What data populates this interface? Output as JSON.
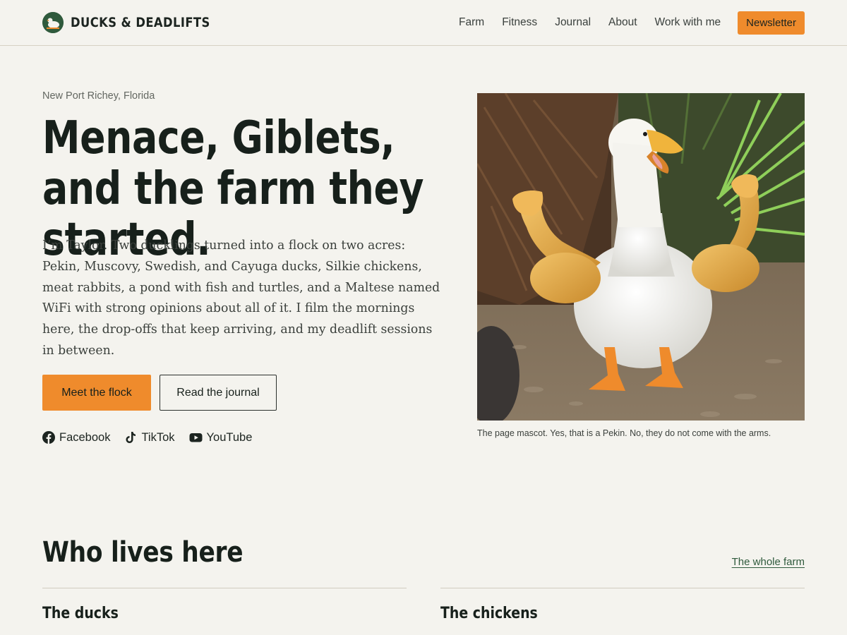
{
  "header": {
    "brand": "DUCKS & DEADLIFTS",
    "nav": [
      "Farm",
      "Fitness",
      "Journal",
      "About",
      "Work with me"
    ],
    "newsletter_label": "Newsletter"
  },
  "hero": {
    "location": "New Port Richey, Florida",
    "title": "Menace, Giblets, and the farm they started.",
    "intro": "I’m Taylor. Two ducklings turned into a flock on two acres: Pekin, Muscovy, Swedish, and Cayuga ducks, Silkie chickens, meat rabbits, a pond with fish and turtles, and a Maltese named WiFi with strong opinions about all of it. I film the mornings here, the drop-offs that keep arriving, and my deadlift sessions in between.",
    "primary_cta": "Meet the flock",
    "secondary_cta": "Read the journal",
    "socials": [
      {
        "label": "Facebook",
        "icon": "facebook-icon"
      },
      {
        "label": "TikTok",
        "icon": "tiktok-icon"
      },
      {
        "label": "YouTube",
        "icon": "youtube-icon"
      }
    ],
    "photo_caption": "The page mascot. Yes, that is a Pekin. No, they do not come with the arms."
  },
  "section": {
    "title": "Who lives here",
    "link": "The whole farm",
    "columns": [
      {
        "title": "The ducks"
      },
      {
        "title": "The chickens"
      }
    ]
  },
  "colors": {
    "accent": "#ef8b2c",
    "brand_green": "#2f5a3c",
    "background": "#f4f3ee",
    "text": "#17201b"
  }
}
